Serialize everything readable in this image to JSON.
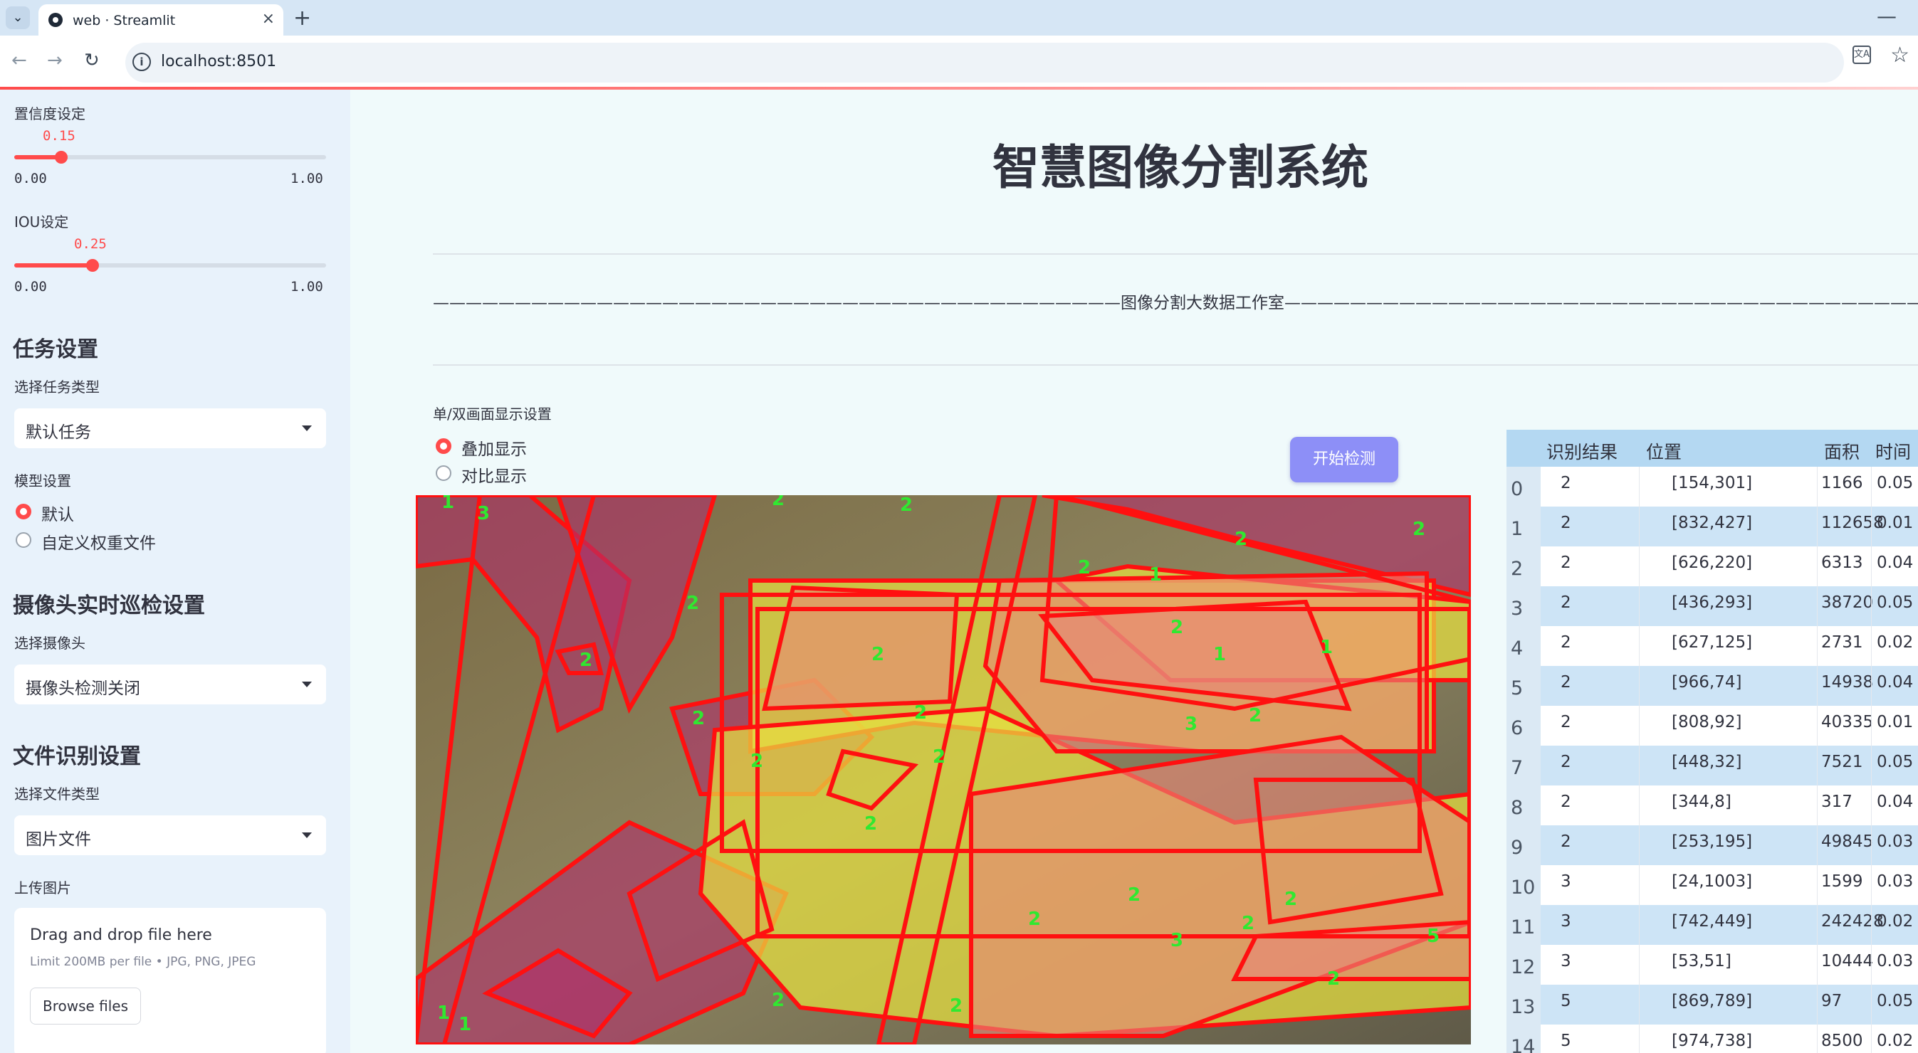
{
  "browser": {
    "tab_title": "web · Streamlit",
    "url": "localhost:8501",
    "new_tab": "+",
    "close": "×",
    "minimize": "—"
  },
  "sidebar": {
    "confidence": {
      "label": "置信度设定",
      "value": "0.15",
      "fraction": 0.15,
      "min": "0.00",
      "max": "1.00"
    },
    "iou": {
      "label": "IOU设定",
      "value": "0.25",
      "fraction": 0.25,
      "min": "0.00",
      "max": "1.00"
    },
    "task_heading": "任务设置",
    "task_type_label": "选择任务类型",
    "task_type_value": "默认任务",
    "model_label": "模型设置",
    "model_options": [
      "默认",
      "自定义权重文件"
    ],
    "camera_heading": "摄像头实时巡检设置",
    "camera_label": "选择摄像头",
    "camera_value": "摄像头检测关闭",
    "file_heading": "文件识别设置",
    "file_type_label": "选择文件类型",
    "file_type_value": "图片文件",
    "upload_label": "上传图片",
    "upload_title": "Drag and drop file here",
    "upload_limit": "Limit 200MB per file • JPG, PNG, JPEG",
    "browse_button": "Browse files"
  },
  "main": {
    "title": "智慧图像分割系统",
    "banner": "——————————————————————————————————————————图像分割大数据工作室——————————————————————————————————————————",
    "display_label": "单/双画面显示设置",
    "display_options": [
      "叠加显示",
      "对比显示"
    ],
    "start_button": "开始检测"
  },
  "overlay_labels": [
    "1",
    "3",
    "2",
    "2",
    "2",
    "2",
    "2",
    "2",
    "1",
    "2",
    "2",
    "1",
    "2",
    "1",
    "2",
    "2",
    "3",
    "2",
    "2",
    "2",
    "2",
    "2",
    "2",
    "2",
    "2",
    "3",
    "2",
    "5",
    "2",
    "2",
    "1",
    "1"
  ],
  "colors": {
    "accent": "#ff4b4b",
    "button": "#8d8ff7",
    "table_header": "#b4d8f2",
    "table_alt": "#cde4f6"
  },
  "table": {
    "headers": [
      "识别结果",
      "位置",
      "面积",
      "时间"
    ],
    "rows": [
      {
        "idx": "0",
        "cls": "2",
        "pos": "[154,301]",
        "area": "1166",
        "time": "0.05"
      },
      {
        "idx": "1",
        "cls": "2",
        "pos": "[832,427]",
        "area": "112658",
        "time": "0.01"
      },
      {
        "idx": "2",
        "cls": "2",
        "pos": "[626,220]",
        "area": "6313",
        "time": "0.04"
      },
      {
        "idx": "3",
        "cls": "2",
        "pos": "[436,293]",
        "area": "38720",
        "time": "0.05"
      },
      {
        "idx": "4",
        "cls": "2",
        "pos": "[627,125]",
        "area": "2731",
        "time": "0.02"
      },
      {
        "idx": "5",
        "cls": "2",
        "pos": "[966,74]",
        "area": "14938",
        "time": "0.04"
      },
      {
        "idx": "6",
        "cls": "2",
        "pos": "[808,92]",
        "area": "40335",
        "time": "0.01"
      },
      {
        "idx": "7",
        "cls": "2",
        "pos": "[448,32]",
        "area": "7521",
        "time": "0.05"
      },
      {
        "idx": "8",
        "cls": "2",
        "pos": "[344,8]",
        "area": "317",
        "time": "0.04"
      },
      {
        "idx": "9",
        "cls": "2",
        "pos": "[253,195]",
        "area": "49845",
        "time": "0.03"
      },
      {
        "idx": "10",
        "cls": "3",
        "pos": "[24,1003]",
        "area": "1599",
        "time": "0.03"
      },
      {
        "idx": "11",
        "cls": "3",
        "pos": "[742,449]",
        "area": "242428",
        "time": "0.02"
      },
      {
        "idx": "12",
        "cls": "3",
        "pos": "[53,51]",
        "area": "10444",
        "time": "0.03"
      },
      {
        "idx": "13",
        "cls": "5",
        "pos": "[869,789]",
        "area": "97",
        "time": "0.05"
      },
      {
        "idx": "14",
        "cls": "5",
        "pos": "[974,738]",
        "area": "8500",
        "time": "0.02"
      }
    ]
  }
}
